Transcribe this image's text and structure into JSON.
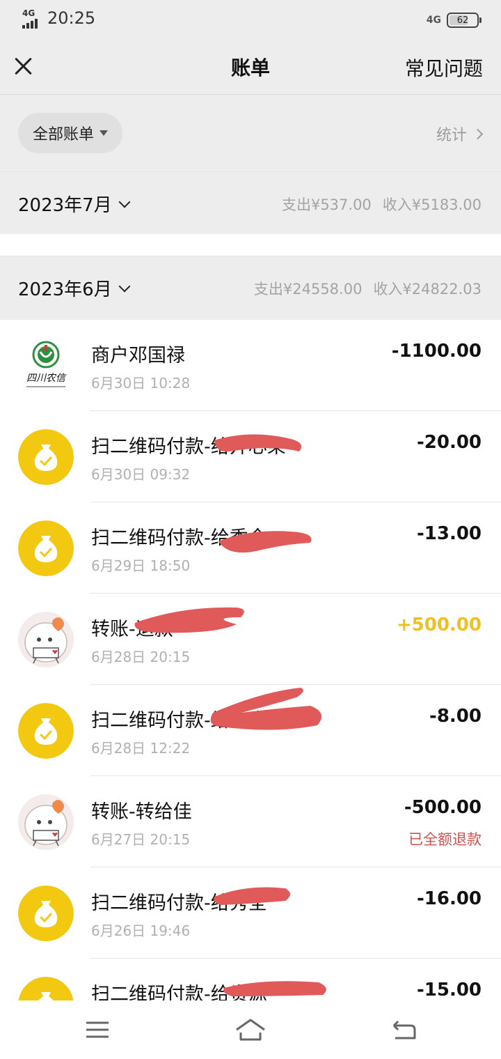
{
  "status_bar": {
    "network": "4G",
    "time": "20:25",
    "right_network": "4G",
    "battery_level": "62"
  },
  "header": {
    "title": "账单",
    "faq_label": "常见问题"
  },
  "filter": {
    "label": "全部账单",
    "stats_label": "统计"
  },
  "months": [
    {
      "label": "2023年7月",
      "expense": "支出¥537.00",
      "income": "收入¥5183.00"
    },
    {
      "label": "2023年6月",
      "expense": "支出¥24558.00",
      "income": "收入¥24822.03"
    }
  ],
  "transactions": [
    {
      "title": "商户邓国禄",
      "date": "6月30日 10:28",
      "amount": "-1100.00",
      "icon": "sichuan-rural-credit-logo",
      "logo_text": "四川农信"
    },
    {
      "title": "扫二维码付款-给开心果",
      "date": "6月30日 09:32",
      "amount": "-20.00",
      "icon": "money-bag-icon"
    },
    {
      "title": "扫二维码付款-给秀全",
      "date": "6月29日 18:50",
      "amount": "-13.00",
      "icon": "money-bag-icon"
    },
    {
      "title": "转账-退款",
      "date": "6月28日 20:15",
      "amount": "+500.00",
      "icon": "cartoon-avatar",
      "type": "income"
    },
    {
      "title": "扫二维码付款-给秀全",
      "date": "6月28日 12:22",
      "amount": "-8.00",
      "icon": "money-bag-icon"
    },
    {
      "title": "转账-转给佳",
      "date": "6月27日 20:15",
      "amount": "-500.00",
      "icon": "cartoon-avatar",
      "note": "已全额退款"
    },
    {
      "title": "扫二维码付款-给秀全",
      "date": "6月26日 19:46",
      "amount": "-16.00",
      "icon": "money-bag-icon"
    },
    {
      "title": "扫二维码付款-给贵源",
      "date": "",
      "amount": "-15.00",
      "icon": "money-bag-icon"
    }
  ],
  "colors": {
    "background": "#ededed",
    "income": "#f0c020",
    "refund_note": "#d05050",
    "coin": "#f2c811",
    "redaction": "#e05a5a"
  }
}
